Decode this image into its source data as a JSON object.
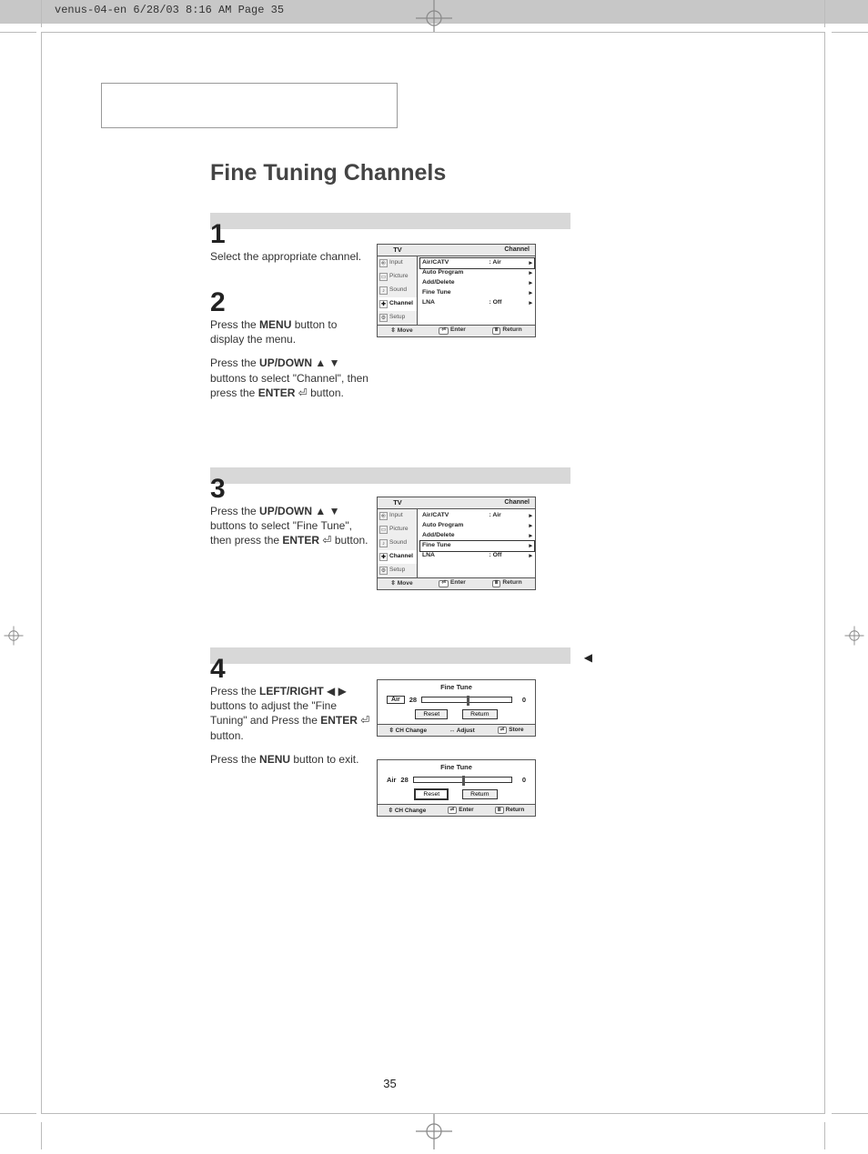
{
  "header_tag": "venus-04-en  6/28/03 8:16 AM  Page 35",
  "title": "Fine Tuning Channels",
  "page_number": "35",
  "steps": {
    "s1": {
      "num": "1",
      "body": "Select the appropriate channel."
    },
    "s2": {
      "num": "2",
      "body_a": "Press the ",
      "body_b": "MENU",
      "body_c": " button to display the menu.",
      "body_d": "Press the ",
      "body_e": "UP/DOWN",
      "body_f": " buttons to select \"Channel\", then press the ",
      "body_g": "ENTER",
      "body_h": " button."
    },
    "s3": {
      "num": "3",
      "body_a": "Press the ",
      "body_b": "UP/DOWN",
      "body_c": " buttons to select \"Fine Tune\", then press the ",
      "body_d": "ENTER",
      "body_e": " button."
    },
    "s4": {
      "num": "4",
      "body_a": "Press the ",
      "body_b": "LEFT/RIGHT",
      "body_c": " buttons to adjust the \"Fine Tuning\" and Press the ",
      "body_d": "ENTER",
      "body_e": "  button.",
      "body_f": "Press the ",
      "body_g": "NENU",
      "body_h": " button to exit."
    }
  },
  "osd": {
    "tv_label": "TV",
    "channel_label": "Channel",
    "side": {
      "input": "Input",
      "picture": "Picture",
      "sound": "Sound",
      "channel": "Channel",
      "setup": "Setup"
    },
    "rows": {
      "aircatv": {
        "label": "Air/CATV",
        "val": ":  Air"
      },
      "autoprogram": {
        "label": "Auto Program",
        "val": ""
      },
      "adddelete": {
        "label": "Add/Delete",
        "val": ""
      },
      "finetune": {
        "label": "Fine Tune",
        "val": ""
      },
      "lna": {
        "label": "LNA",
        "val": ":  Off"
      }
    },
    "foot": {
      "move": "Move",
      "enter": "Enter",
      "return": "Return"
    }
  },
  "ft": {
    "title": "Fine Tune",
    "source": "Air",
    "chan": "28",
    "value": "0",
    "reset": "Reset",
    "return": "Return",
    "foot_a": {
      "chchange": "CH Change",
      "adjust": "Adjust",
      "store": "Store"
    },
    "foot_b": {
      "chchange": "CH Change",
      "enter": "Enter",
      "return": "Return"
    }
  },
  "glyph": {
    "updown": "▲ ▼",
    "leftright": "◀ ▶",
    "enter": "⏎",
    "menu": "Ⅲ",
    "tri": "▸",
    "updn2": "⇳",
    "lr2": "↔"
  }
}
